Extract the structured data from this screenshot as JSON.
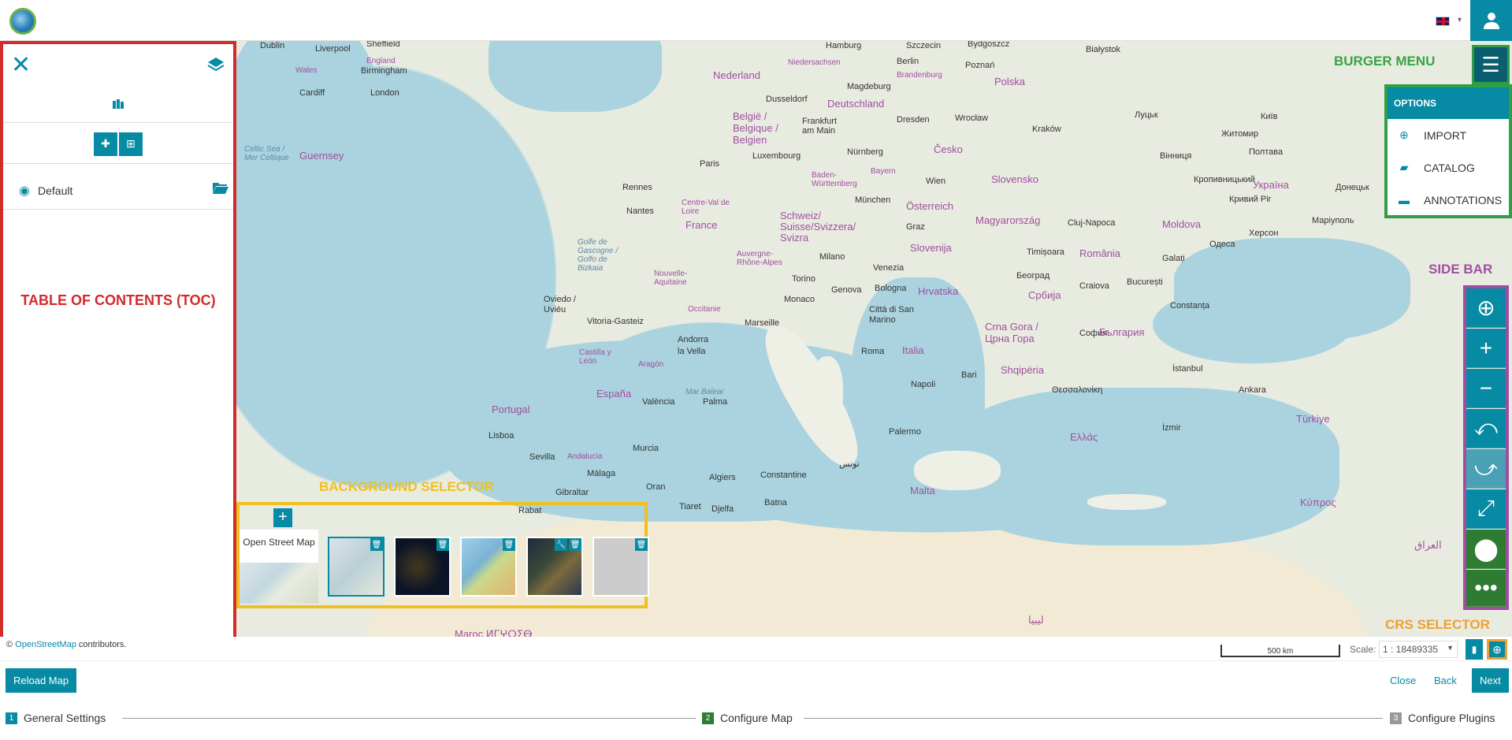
{
  "header": {
    "language_caret": "▾"
  },
  "toc": {
    "default_group_label": "Default",
    "annotation_title": "TABLE OF CONTENTS (TOC)"
  },
  "background_selector": {
    "annotation_title": "BACKGROUND SELECTOR",
    "first_layer_label": "Open Street Map"
  },
  "burger_menu": {
    "annotation_title": "BURGER MENU",
    "header": "OPTIONS",
    "items": [
      {
        "label": "IMPORT",
        "icon": "import-icon"
      },
      {
        "label": "CATALOG",
        "icon": "folder-open-icon"
      },
      {
        "label": "ANNOTATIONS",
        "icon": "comment-icon"
      }
    ]
  },
  "sidebar": {
    "annotation_title": "SIDE BAR",
    "buttons": [
      "locate-icon",
      "zoom-in-icon",
      "zoom-out-icon",
      "zoom-previous-icon",
      "zoom-next-icon",
      "fullscreen-icon",
      "marker-icon",
      "more-icon"
    ]
  },
  "crs": {
    "annotation_title": "CRS SELECTOR"
  },
  "map": {
    "labels": {
      "dublin": "Dublin",
      "liverpool": "Liverpool",
      "sheffield": "Sheffield",
      "birmingham": "Birmingham",
      "wales": "Wales",
      "england": "England",
      "cardiff": "Cardiff",
      "london": "London",
      "hamburg": "Hamburg",
      "szczecin": "Szczecin",
      "bydgoszcz": "Bydgoszcz",
      "bialystok": "Białystok",
      "nederland": "Nederland",
      "berlin": "Berlin",
      "poznan": "Poznań",
      "niedersachsen": "Niedersachsen",
      "brandenburg": "Brandenburg",
      "magdeburg": "Magdeburg",
      "polska": "Polska",
      "dusseldorf": "Dusseldorf",
      "deutschland": "Deutschland",
      "belgie": "België / Belgique / Belgien",
      "frankfurt": "Frankfurt am Main",
      "dresden": "Dresden",
      "wroclaw": "Wrocław",
      "krakow": "Kraków",
      "lutsk": "Луцьк",
      "zhytomyr": "Житомир",
      "kyiv": "Київ",
      "guernsey": "Guernsey",
      "celtic_sea": "Celtic Sea / Mer Celtique",
      "paris": "Paris",
      "luxembourg": "Luxembourg",
      "nurnberg": "Nürnberg",
      "cesko": "Česko",
      "rennes": "Rennes",
      "bayern": "Bayern",
      "baden": "Baden-Württemberg",
      "wien": "Wien",
      "slovensko": "Slovensko",
      "nantes": "Nantes",
      "centre": "Centre-Val de Loire",
      "munchen": "München",
      "osterreich": "Österreich",
      "france": "France",
      "schweiz": "Schweiz/ Suisse/Svizzera/ Svizra",
      "graz": "Graz",
      "magyarorszag": "Magyarország",
      "clujnapoca": "Cluj-Napoca",
      "moldova": "Moldova",
      "vinnytsia": "Вінниця",
      "poltava": "Полтава",
      "ukraina": "Україна",
      "kryvyi": "Кривий Ріг",
      "kropyvnytskyi": "Кропивницький",
      "donetsk": "Донецьк",
      "golfe": "Golfe de Gascogne / Golfo de Bizkaia",
      "nouvelle": "Nouvelle-Aquitaine",
      "auvergne": "Auvergne-Rhône-Alpes",
      "milano": "Milano",
      "venezia": "Venezia",
      "slovenija": "Slovenija",
      "timisoara": "Timișoara",
      "romania": "România",
      "galati": "Galați",
      "kherson": "Херсон",
      "mariupol": "Маріуполь",
      "odesa": "Одеса",
      "torino": "Torino",
      "genova": "Genova",
      "bologna": "Bologna",
      "hrvatska": "Hrvatska",
      "beograd": "Београд",
      "srbija": "Србија",
      "craiova": "Craiova",
      "bucuresti": "București",
      "oviedo": "Oviedo / Uviéu",
      "monaco": "Monaco",
      "sanmarino": "Città di San Marino",
      "constanta": "Constanța",
      "vitoria": "Vitoria-Gasteiz",
      "occitanie": "Occitanie",
      "marseille": "Marseille",
      "andorra": "Andorra la Vella",
      "roma": "Roma",
      "italia": "Italia",
      "crnagora": "Crna Gora / Црна Гора",
      "sofia": "София",
      "bulgaria": "България",
      "castilla": "Castilla y León",
      "aragon": "Aragón",
      "shqiperia": "Shqipëria",
      "istanbul": "İstanbul",
      "portugal": "Portugal",
      "espana": "España",
      "valencia": "València",
      "palma": "Palma",
      "mar_balear": "Mar Balear",
      "napoli": "Napoli",
      "bari": "Bari",
      "thessaloniki": "Θεσσαλονίκη",
      "lisboa": "Lisboa",
      "sevilla": "Sevilla",
      "andalucia": "Andalucía",
      "murcia": "Murcia",
      "palermo": "Palermo",
      "ellas": "Ελλάς",
      "izmir": "İzmir",
      "malaga": "Málaga",
      "gibraltar": "Gibraltar",
      "oran": "Oran",
      "algiers": "Algiers",
      "constantine": "Constantine",
      "tunis": "تونس",
      "malta": "Malta",
      "rabat": "Rabat",
      "tiaret": "Tiaret",
      "djelfa": "Djelfa",
      "batna": "Batna",
      "turkiye": "Türkiye",
      "ankara": "Ankara",
      "kypros": "Κύπρος",
      "iraq": "العراق",
      "maroc": "Maroc ⵍⵎⵖⵔⵉⴱ",
      "libya": "ليبيا",
      "scale_text": "500 km"
    }
  },
  "footer": {
    "attribution_prefix": "©",
    "attribution_link": "OpenStreetMap",
    "attribution_suffix": "contributors.",
    "scale_label": "Scale:",
    "scale_value": "1 : 18489335",
    "reload_button": "Reload Map",
    "close_button": "Close",
    "back_button": "Back",
    "next_button": "Next",
    "steps": [
      {
        "num": "1",
        "label": "General Settings"
      },
      {
        "num": "2",
        "label": "Configure Map"
      },
      {
        "num": "3",
        "label": "Configure Plugins"
      }
    ]
  }
}
